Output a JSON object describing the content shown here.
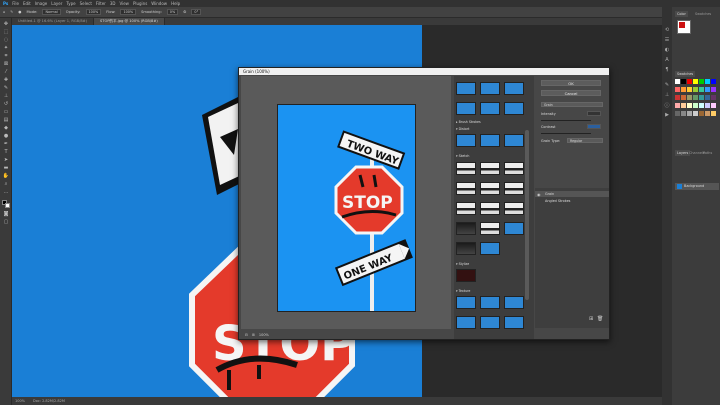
{
  "menubar": [
    "Ps",
    "File",
    "Edit",
    "Image",
    "Layer",
    "Type",
    "Select",
    "Filter",
    "3D",
    "View",
    "Plugins",
    "Window",
    "Help"
  ],
  "options": {
    "mode_label": "Mode:",
    "mode_value": "Normal",
    "opacity_label": "Opacity:",
    "opacity_value": "100%",
    "flow_label": "Flow:",
    "flow_value": "100%",
    "smoothing_label": "Smoothing:",
    "smoothing_value": "0%",
    "angle_value": "0°"
  },
  "tabs": [
    {
      "label": "Untitled-1 @ 16.6% (Layer 1, RGB/8#)"
    },
    {
      "label": "STOP的平.jpg @ 100% (RGB/8#)"
    }
  ],
  "status": {
    "zoom": "100%",
    "doc": "Doc: 2.82M/2.82M"
  },
  "dialog": {
    "title": "Grain (100%)",
    "ok": "OK",
    "cancel": "Cancel",
    "filter_select": "Grain",
    "intensity_label": "Intensity",
    "contrast_label": "Contrast",
    "grain_type_label": "Grain Type:",
    "grain_type_value": "Regular",
    "zoom_value": "100%",
    "layers": [
      {
        "label": "Grain"
      },
      {
        "label": "Angled Strokes"
      }
    ],
    "folders": [
      "Brush Strokes",
      "Distort",
      "Sketch",
      "Stylize",
      "Texture"
    ]
  },
  "preview_signs": {
    "top": "TWO WAY",
    "middle": "STOP",
    "bottom": "ONE WAY"
  },
  "canvas_sign": {
    "text": "STOP"
  },
  "panels": {
    "color": "Color",
    "swatches": "Swatches",
    "layers": "Layers",
    "channels": "Channels",
    "paths": "Paths",
    "layer_name": "Background"
  },
  "colors": {
    "canvas_blue": "#1a7fd6",
    "preview_blue": "#1b93f2",
    "stop_red": "#e43a2b"
  }
}
